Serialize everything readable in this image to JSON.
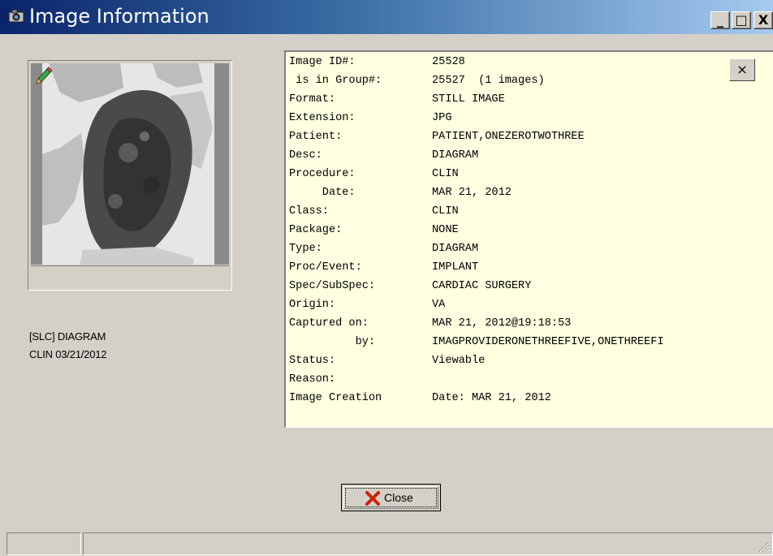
{
  "window": {
    "title": "Image Information",
    "minimize_label": "_",
    "maximize_label": "□",
    "close_label": "X"
  },
  "thumbnail": {
    "caption_line1": "[SLC] DIAGRAM",
    "caption_line2": "CLIN 03/21/2012"
  },
  "info": {
    "close_label": "×",
    "rows": [
      {
        "label": "Image ID#:",
        "value": "25528"
      },
      {
        "label": " is in Group#:",
        "value": "25527  (1 images)"
      },
      {
        "label": "Format:",
        "value": "STILL IMAGE"
      },
      {
        "label": "Extension:",
        "value": "JPG"
      },
      {
        "label": "Patient:",
        "value": "PATIENT,ONEZEROTWOTHREE"
      },
      {
        "label": "Desc:",
        "value": "DIAGRAM"
      },
      {
        "label": "Procedure:",
        "value": "CLIN"
      },
      {
        "label": "     Date:",
        "value": "MAR 21, 2012"
      },
      {
        "label": "Class:",
        "value": "CLIN"
      },
      {
        "label": "Package:",
        "value": "NONE"
      },
      {
        "label": "Type:",
        "value": "DIAGRAM"
      },
      {
        "label": "Proc/Event:",
        "value": "IMPLANT"
      },
      {
        "label": "Spec/SubSpec:",
        "value": "CARDIAC SURGERY"
      },
      {
        "label": "Origin:",
        "value": "VA"
      },
      {
        "label": "Captured on:",
        "value": "MAR 21, 2012@19:18:53"
      },
      {
        "label": "          by:",
        "value": "IMAGPROVIDERONETHREEFIVE,ONETHREEFI"
      },
      {
        "label": "Status:",
        "value": "Viewable"
      },
      {
        "label": "Reason:",
        "value": ""
      },
      {
        "label": "Image Creation",
        "value": "Date: MAR 21, 2012"
      }
    ]
  },
  "footer": {
    "close_button_label": "Close"
  },
  "colors": {
    "window_bg": "#d4d0c8",
    "info_bg": "#ffffe1",
    "titlebar_start": "#0a246a",
    "titlebar_end": "#a6caf0",
    "close_x": "#cc2200"
  },
  "icons": {
    "title": "camera-icon",
    "thumb_edit": "pencil-icon",
    "close_button": "red-x-icon"
  }
}
